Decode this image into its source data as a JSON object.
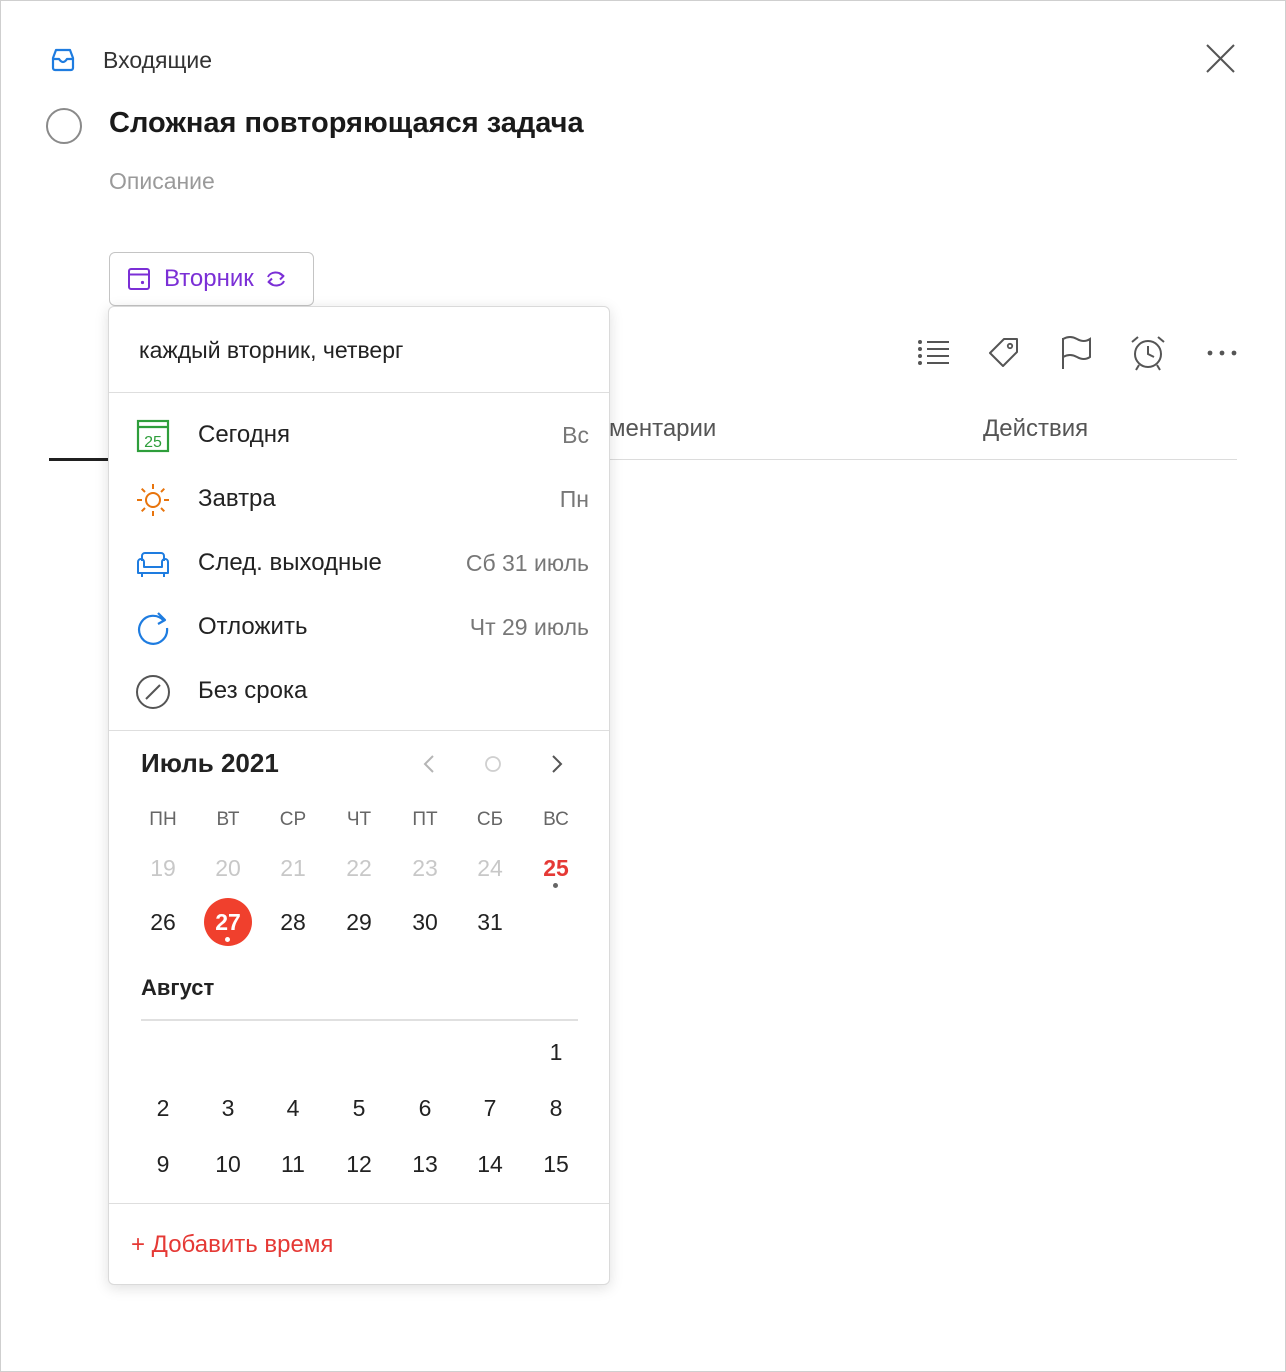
{
  "header": {
    "project_label": "Входящие",
    "task_title": "Сложная повторяющаяся задача",
    "description_placeholder": "Описание",
    "date_chip_label": "Вторник"
  },
  "tabs": {
    "comments_partial": "ментарии",
    "actions": "Действия"
  },
  "toolbar": [
    "list-icon",
    "tag-icon",
    "flag-icon",
    "alarm-icon",
    "more-icon"
  ],
  "popup": {
    "recurrence_text": "каждый вторник, четверг",
    "quick_options": [
      {
        "label": "Сегодня",
        "hint": "Вс",
        "icon": "calendar-today-icon",
        "color": "#2e9e3b",
        "icon_text": "25"
      },
      {
        "label": "Завтра",
        "hint": "Пн",
        "icon": "sun-icon",
        "color": "#e8740c"
      },
      {
        "label": "След. выходные",
        "hint": "Сб 31 июль",
        "icon": "sofa-icon",
        "color": "#1e7ce0"
      },
      {
        "label": "Отложить",
        "hint": "Чт 29 июль",
        "icon": "postpone-icon",
        "color": "#1e7ce0"
      },
      {
        "label": "Без срока",
        "hint": "",
        "icon": "no-date-icon",
        "color": "#555555"
      }
    ],
    "calendar": {
      "month_title": "Июль 2021",
      "weekdays": [
        "ПН",
        "ВТ",
        "СР",
        "ЧТ",
        "ПТ",
        "СБ",
        "ВС"
      ],
      "july_week1": [
        "19",
        "20",
        "21",
        "22",
        "23",
        "24",
        "25"
      ],
      "july_week2": [
        "26",
        "27",
        "28",
        "29",
        "30",
        "31"
      ],
      "august_title": "Август",
      "august_week1": [
        "1"
      ],
      "august_week2": [
        "2",
        "3",
        "4",
        "5",
        "6",
        "7",
        "8"
      ],
      "august_week3": [
        "9",
        "10",
        "11",
        "12",
        "13",
        "14",
        "15"
      ],
      "today": "25",
      "selected": "27",
      "accent_color": "#f0402d"
    },
    "add_time_label": "+ Добавить время"
  },
  "colors": {
    "chip_text": "#7b2fd6",
    "inbox_icon": "#1e7ce0",
    "today_red": "#e53935"
  }
}
